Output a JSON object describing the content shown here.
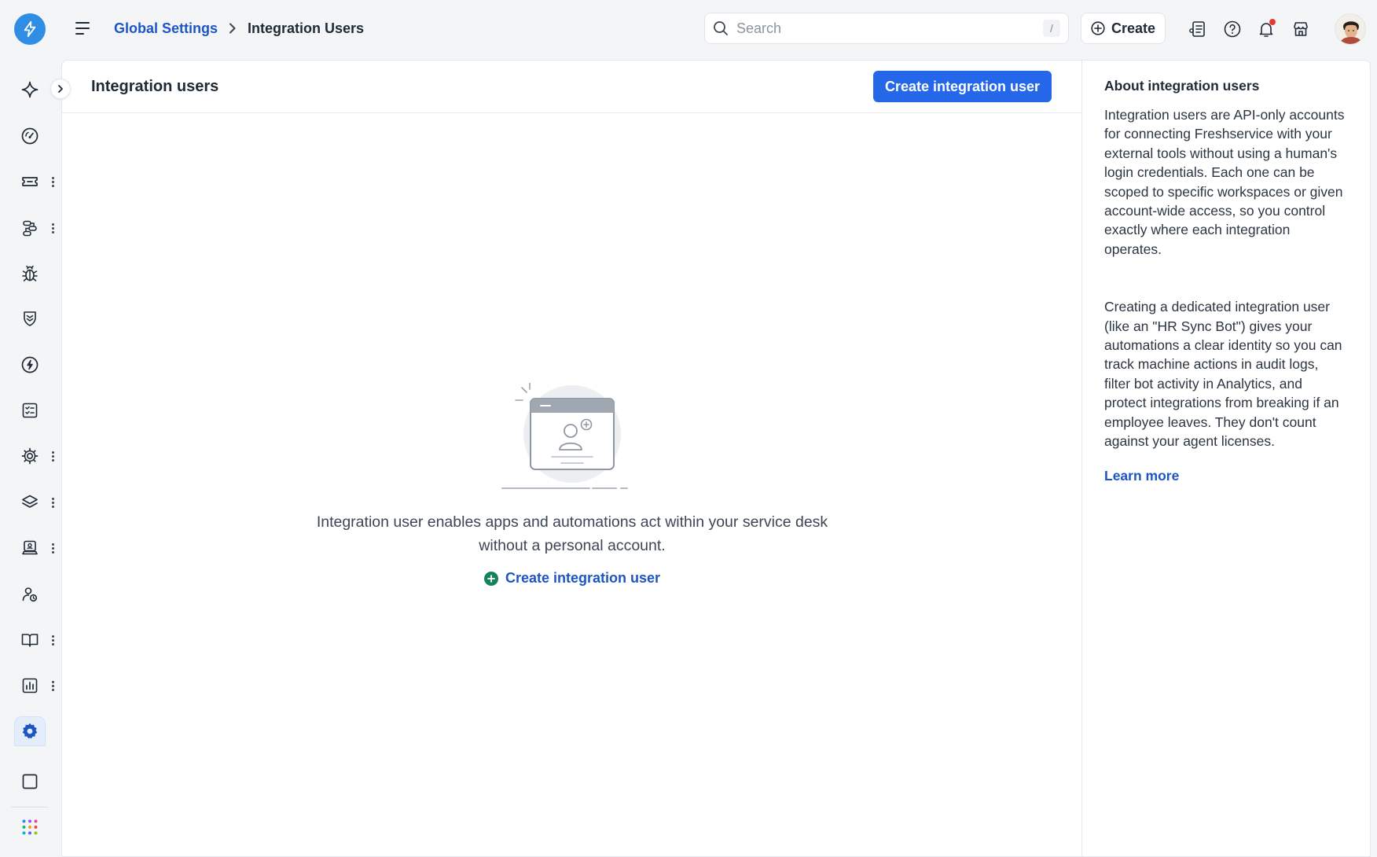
{
  "breadcrumb": {
    "parent": "Global Settings",
    "current": "Integration Users"
  },
  "search": {
    "placeholder": "Search",
    "shortcut": "/"
  },
  "topbar": {
    "create_label": "Create"
  },
  "main": {
    "title": "Integration users",
    "create_button_label": "Create integration user",
    "empty_text": "Integration user enables apps and automations act within your service desk without a personal account.",
    "empty_link_label": "Create integration user"
  },
  "aside": {
    "title": "About integration users",
    "paragraph1": "Integration users are API-only accounts for connecting Freshservice with your external tools without using a human's login credentials. Each one can be scoped to specific workspaces or given account-wide access, so you control exactly where each integration operates.",
    "paragraph2": "Creating a dedicated integration user (like an \"HR Sync Bot\") gives your automations a clear identity so you can track machine actions in audit logs, filter bot activity in Analytics, and protect integrations from breaking if an employee leaves. They don't count against your agent licenses.",
    "learn_more": "Learn more"
  },
  "colors": {
    "accent": "#2467e8",
    "link": "#1d55c4",
    "logo": "#2f8de4",
    "notification_dot": "#e53b2f",
    "active_nav_bg": "#e4eefb"
  },
  "nav_icons": [
    "sparkle-icon",
    "dashboard-icon",
    "ticket-icon",
    "flow-icon",
    "bug-icon",
    "shield-icon",
    "change-icon",
    "checklist-icon",
    "gears-icon",
    "layers-icon",
    "laptop-icon",
    "user-gear-icon",
    "book-icon",
    "chart-icon",
    "settings-icon",
    "square-icon",
    "apps-grid-icon"
  ]
}
